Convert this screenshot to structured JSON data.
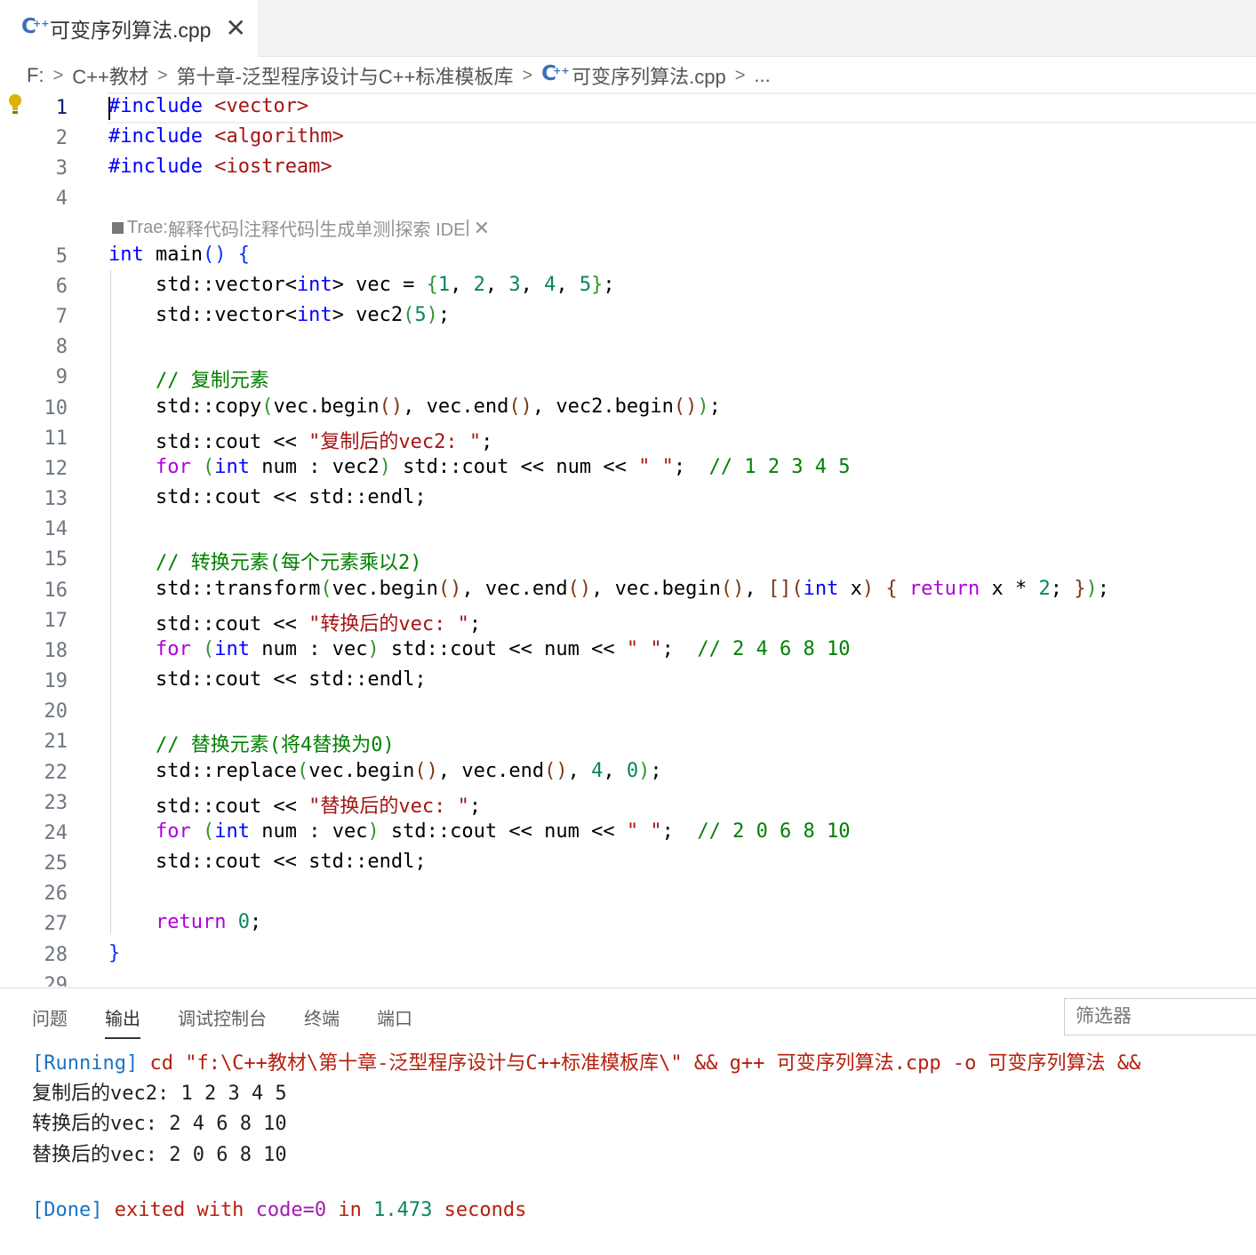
{
  "tab": {
    "title": "可变序列算法.cpp",
    "close": "✕"
  },
  "breadcrumb": [
    "F:",
    "C++教材",
    "第十章-泛型程序设计与C++标准模板库",
    "可变序列算法.cpp",
    "..."
  ],
  "codelens": {
    "prefix": "Trae: ",
    "items": [
      "解释代码",
      "注释代码",
      "生成单测",
      "探索 IDE"
    ],
    "separator": " | ",
    "close": "✕"
  },
  "line_numbers": [
    "1",
    "2",
    "3",
    "4",
    "5",
    "6",
    "7",
    "8",
    "9",
    "10",
    "11",
    "12",
    "13",
    "14",
    "15",
    "16",
    "17",
    "18",
    "19",
    "20",
    "21",
    "22",
    "23",
    "24",
    "25",
    "26",
    "27",
    "28",
    "29"
  ],
  "code": {
    "inc": "#include",
    "hdr": [
      "<vector>",
      "<algorithm>",
      "<iostream>"
    ],
    "kw_int": "int",
    "main": " main",
    "std_vector": "std::vector",
    "vec_assign": " vec = ",
    "vec_init": [
      "1",
      "2",
      "3",
      "4",
      "5"
    ],
    "vec2": " vec2",
    "n5": "5",
    "c_copy": "// 复制元素",
    "copy_fn": "std::copy",
    "begin_vec": "vec.begin",
    "end_vec": "vec.end",
    "begin_vec2": "vec2.begin",
    "cout": "std::cout << ",
    "s_copy": "\"复制后的vec2: \"",
    "for": "for",
    "num_colon_vec2": " num : vec2",
    "num_colon_vec": " num : vec",
    "cout_num": " std::cout << num << ",
    "space_str": "\" \"",
    "c_r1": "// 1 2 3 4 5",
    "endl": "std::cout << std::endl;",
    "c_transform": "// 转换元素(每个元素乘以2)",
    "transform_fn": "std::transform",
    "lambda_param": " x",
    "return": "return",
    "times2": " x * ",
    "n2": "2",
    "s_transform": "\"转换后的vec: \"",
    "c_r2": "// 2 4 6 8 10",
    "c_replace": "// 替换元素(将4替换为0)",
    "replace_fn": "std::replace",
    "n4": "4",
    "n0": "0",
    "s_replace": "\"替换后的vec: \"",
    "c_r3": "// 2 0 6 8 10"
  },
  "panel": {
    "tabs": [
      "问题",
      "输出",
      "调试控制台",
      "终端",
      "端口"
    ],
    "active_tab": "输出",
    "filter_placeholder": "筛选器",
    "running_tag": "[Running]",
    "running_cmd": "cd \"f:\\C++教材\\第十章-泛型程序设计与C++标准模板库\\\" && g++ 可变序列算法.cpp -o 可变序列算法 &&",
    "output_lines": [
      "复制后的vec2: 1 2 3 4 5",
      "转换后的vec: 2 4 6 8 10",
      "替换后的vec: 2 0 6 8 10"
    ],
    "done_tag": "[Done]",
    "done_exited": "exited with ",
    "done_code": "code=0",
    "done_in": " in ",
    "done_time": "1.473",
    "done_seconds": " seconds"
  }
}
